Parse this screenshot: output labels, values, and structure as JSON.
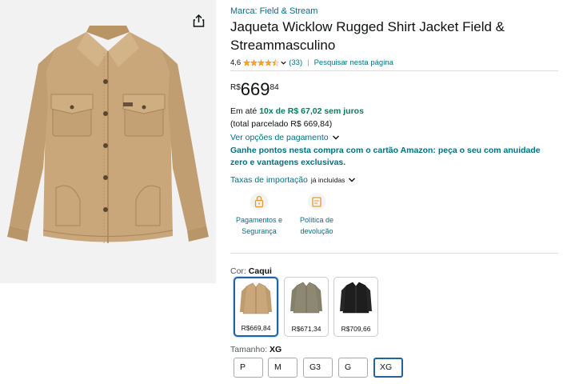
{
  "product": {
    "brand_line": "Marca: Field & Stream",
    "title": "Jaqueta Wicklow Rugged Shirt Jacket Field & Streammasculino",
    "rating_value": "4,6",
    "rating_count": "(33)",
    "rating_stars": 4.5,
    "search_page_link": "Pesquisar nesta página"
  },
  "price": {
    "currency": "R$",
    "whole": "669",
    "cents": "84",
    "install_prefix": "Em até ",
    "install_highlight": "10x de R$ 67,02 sem juros",
    "total_installment": "(total parcelado R$ 669,84)",
    "payment_options_link": "Ver opções de pagamento",
    "promo_text": "Ganhe pontos nesta compra com o cartão Amazon: peça o seu com anuidade zero e vantagens exclusivas.",
    "import_fees_link": "Taxas de importação",
    "import_fees_note": "já incluídas"
  },
  "features": [
    {
      "line1": "Pagamentos e",
      "line2": "Segurança",
      "icon": "secure-payment-icon"
    },
    {
      "line1": "Política de",
      "line2": "devolução",
      "icon": "return-policy-icon"
    }
  ],
  "color": {
    "label": "Cor: ",
    "selected": "Caqui",
    "options": [
      {
        "price": "R$669,84",
        "color": "#c7a67a",
        "selected": true
      },
      {
        "price": "R$671,34",
        "color": "#8e8873",
        "selected": false
      },
      {
        "price": "R$709,66",
        "color": "#1e1e1e",
        "selected": false
      }
    ]
  },
  "size": {
    "label": "Tamanho: ",
    "selected": "XG",
    "options": [
      "P",
      "M",
      "G3",
      "G",
      "XG"
    ]
  },
  "colors": {
    "link": "#007185",
    "green": "#067d62",
    "star": "#ffa41c",
    "selected_border": "#2162a1",
    "jacket_main": "#c8a67a"
  }
}
